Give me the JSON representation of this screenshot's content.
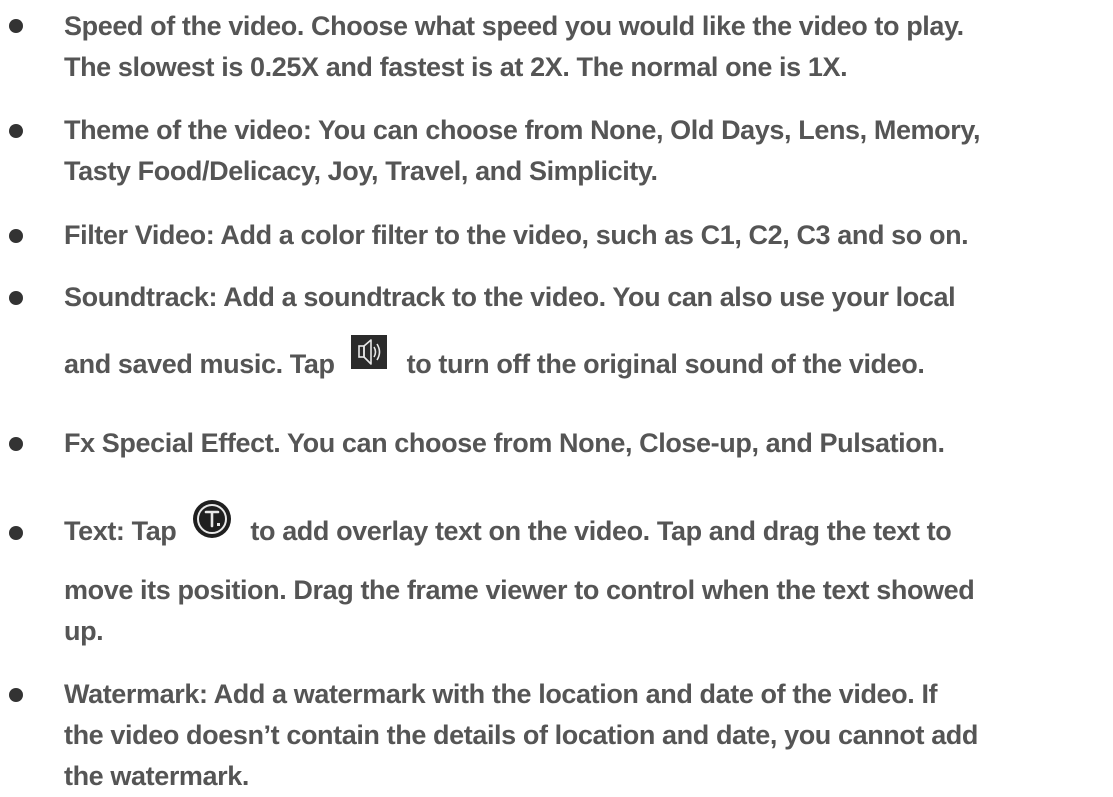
{
  "bullets": [
    {
      "lines": [
        "Speed of the video. Choose what speed you would like the video to play.",
        "The slowest is 0.25X and fastest is at 2X. The normal one is 1X."
      ]
    },
    {
      "lines": [
        "Theme of the video: You can choose from None, Old Days, Lens, Memory,",
        "Tasty Food/Delicacy, Joy, Travel, and Simplicity."
      ]
    },
    {
      "lines": [
        "Filter Video: Add a color filter to the video, such as C1, C2, C3 and so on."
      ]
    },
    {
      "line1": "Soundtrack: Add a soundtrack to the video. You can also use your local",
      "line2_before": "and saved music. Tap",
      "line2_after": "to turn off the original sound of the video.",
      "icon": "speaker-icon"
    },
    {
      "lines": [
        "Fx Special Effect. You can choose from None, Close-up, and Pulsation."
      ]
    },
    {
      "line1_before": "Text: Tap",
      "line1_after": "to add overlay text on the video. Tap and drag the text to",
      "line2": "move its position. Drag the frame viewer to control when the text showed",
      "line3": "up.",
      "icon": "text-overlay-icon"
    },
    {
      "lines": [
        "Watermark: Add a watermark with the location and date of the video. If",
        "the video doesn’t contain the details of location and date, you cannot add",
        "the watermark."
      ]
    }
  ],
  "colors": {
    "text": "#555555",
    "bullet": "#333333",
    "icon_bg": "#2b2b2b"
  }
}
